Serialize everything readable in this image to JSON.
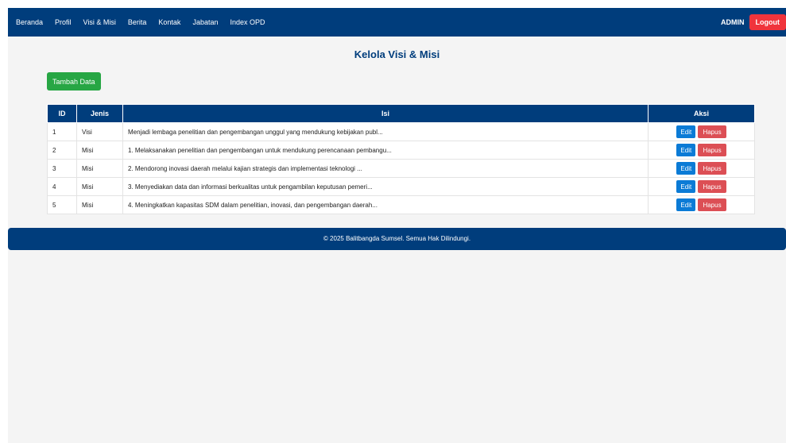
{
  "navbar": {
    "links": [
      "Beranda",
      "Profil",
      "Visi & Misi",
      "Berita",
      "Kontak",
      "Jabatan",
      "Index OPD"
    ],
    "user": "ADMIN",
    "logout_label": "Logout"
  },
  "main": {
    "title": "Kelola Visi & Misi",
    "add_button_label": "Tambah Data",
    "table": {
      "headers": [
        "ID",
        "Jenis",
        "Isi",
        "Aksi"
      ],
      "rows": [
        {
          "id": "1",
          "jenis": "Visi",
          "isi": "Menjadi lembaga penelitian dan pengembangan unggul yang mendukung kebijakan publ..."
        },
        {
          "id": "2",
          "jenis": "Misi",
          "isi": "1. Melaksanakan penelitian dan pengembangan untuk mendukung perencanaan pembangu..."
        },
        {
          "id": "3",
          "jenis": "Misi",
          "isi": "2. Mendorong inovasi daerah melalui kajian strategis dan implementasi teknologi ..."
        },
        {
          "id": "4",
          "jenis": "Misi",
          "isi": "3. Menyediakan data dan informasi berkualitas untuk pengambilan keputusan pemeri..."
        },
        {
          "id": "5",
          "jenis": "Misi",
          "isi": "4. Meningkatkan kapasitas SDM dalam penelitian, inovasi, dan pengembangan daerah..."
        }
      ],
      "edit_label": "Edit",
      "delete_label": "Hapus"
    }
  },
  "footer": {
    "text": "© 2025 Balitbangda Sumsel. Semua Hak Dilindungi."
  },
  "colors": {
    "navy": "#003d7c",
    "green": "#27a644",
    "edit_blue": "#0b7bd6",
    "delete_red": "#dc4f55",
    "logout_red": "#f0343c"
  }
}
